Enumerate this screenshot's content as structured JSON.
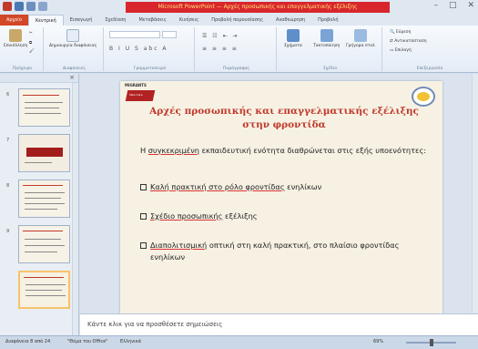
{
  "window": {
    "title": "Microsoft PowerPoint — Αρχές προσωπικής και επαγγελματικής εξέλιξης",
    "controls": [
      "–",
      "□",
      "✕"
    ]
  },
  "tabs": [
    "Αρχείο",
    "Κεντρική",
    "Εισαγωγή",
    "Σχεδίαση",
    "Μεταβάσεις",
    "Κινήσεις",
    "Προβολή παρουσίασης",
    "Αναθεώρηση",
    "Προβολή"
  ],
  "ribbon": {
    "paste_label": "Επικόλληση",
    "clipboard_label": "Πρόχειρο",
    "new_slide_label": "Δημιουργία διαφάνειας",
    "slides_label": "Διαφάνειες",
    "font_label": "Γραμματοσειρά",
    "paragraph_label": "Παράγραφος",
    "drawing_label": "Σχέδιο",
    "shapes_label": "Σχήματα",
    "arrange_label": "Τακτοποίηση",
    "quick_styles_label": "Γρήγορα στυλ",
    "editing_label": "Επεξεργασία",
    "find_label": "Εύρεση",
    "replace_label": "Αντικατάσταση",
    "select_label": "Επιλογή"
  },
  "left_pane": {
    "slide_numbers": [
      "6",
      "7",
      "8",
      "9"
    ]
  },
  "slide": {
    "logo_text": "MIGRANTS",
    "logo_sub": "Take Care",
    "title": "Αρχές προσωπικής και επαγγελματικής εξέλιξης στην φροντίδα",
    "intro_pre": "Η ",
    "intro_ul": "συγκεκριμένη",
    "intro_post": " εκπαιδευτική ενότητα διαθρώνεται στις εξής υποενότητες:",
    "bullet1_ul": "Καλή πρακτική στο ρόλο φροντίδας",
    "bullet1_post": " ενηλίκων",
    "bullet2_ul": "Σχέδιο προσωπικής",
    "bullet2_post": " εξέλιξης",
    "bullet3_ul": "Διαπολιτισμική",
    "bullet3_post": " οπτική στη καλή πρακτική, στο πλαίσιο φροντίδας ενηλίκων"
  },
  "notes": {
    "placeholder": "Κάντε κλικ για να προσθέσετε σημειώσεις"
  },
  "status": {
    "slide_info": "Διαφάνεια 8 από 24",
    "theme": "\"Θέμα του Office\"",
    "language": "Ελληνικά",
    "zoom": "69%"
  },
  "colors": {
    "title_bar_highlight": "#d8262c",
    "file_tab": "#d24726",
    "slide_title": "#c0392b",
    "slide_bg": "#f6f1e3",
    "selected_thumb": "#f6c36a"
  }
}
